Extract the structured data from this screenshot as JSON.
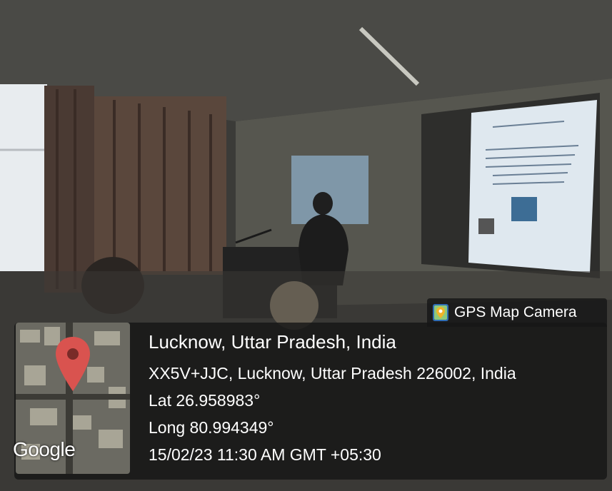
{
  "overlay": {
    "app_name": "GPS Map Camera",
    "location_title": "Lucknow, Uttar Pradesh, India",
    "address": "XX5V+JJC, Lucknow, Uttar Pradesh 226002, India",
    "latitude": "Lat 26.958983°",
    "longitude": "Long 80.994349°",
    "timestamp": "15/02/23 11:30 AM GMT +05:30",
    "map_attribution": "Google"
  },
  "colors": {
    "pin": "#d9534f",
    "panel_bg": "#161616",
    "text": "#ffffff"
  }
}
